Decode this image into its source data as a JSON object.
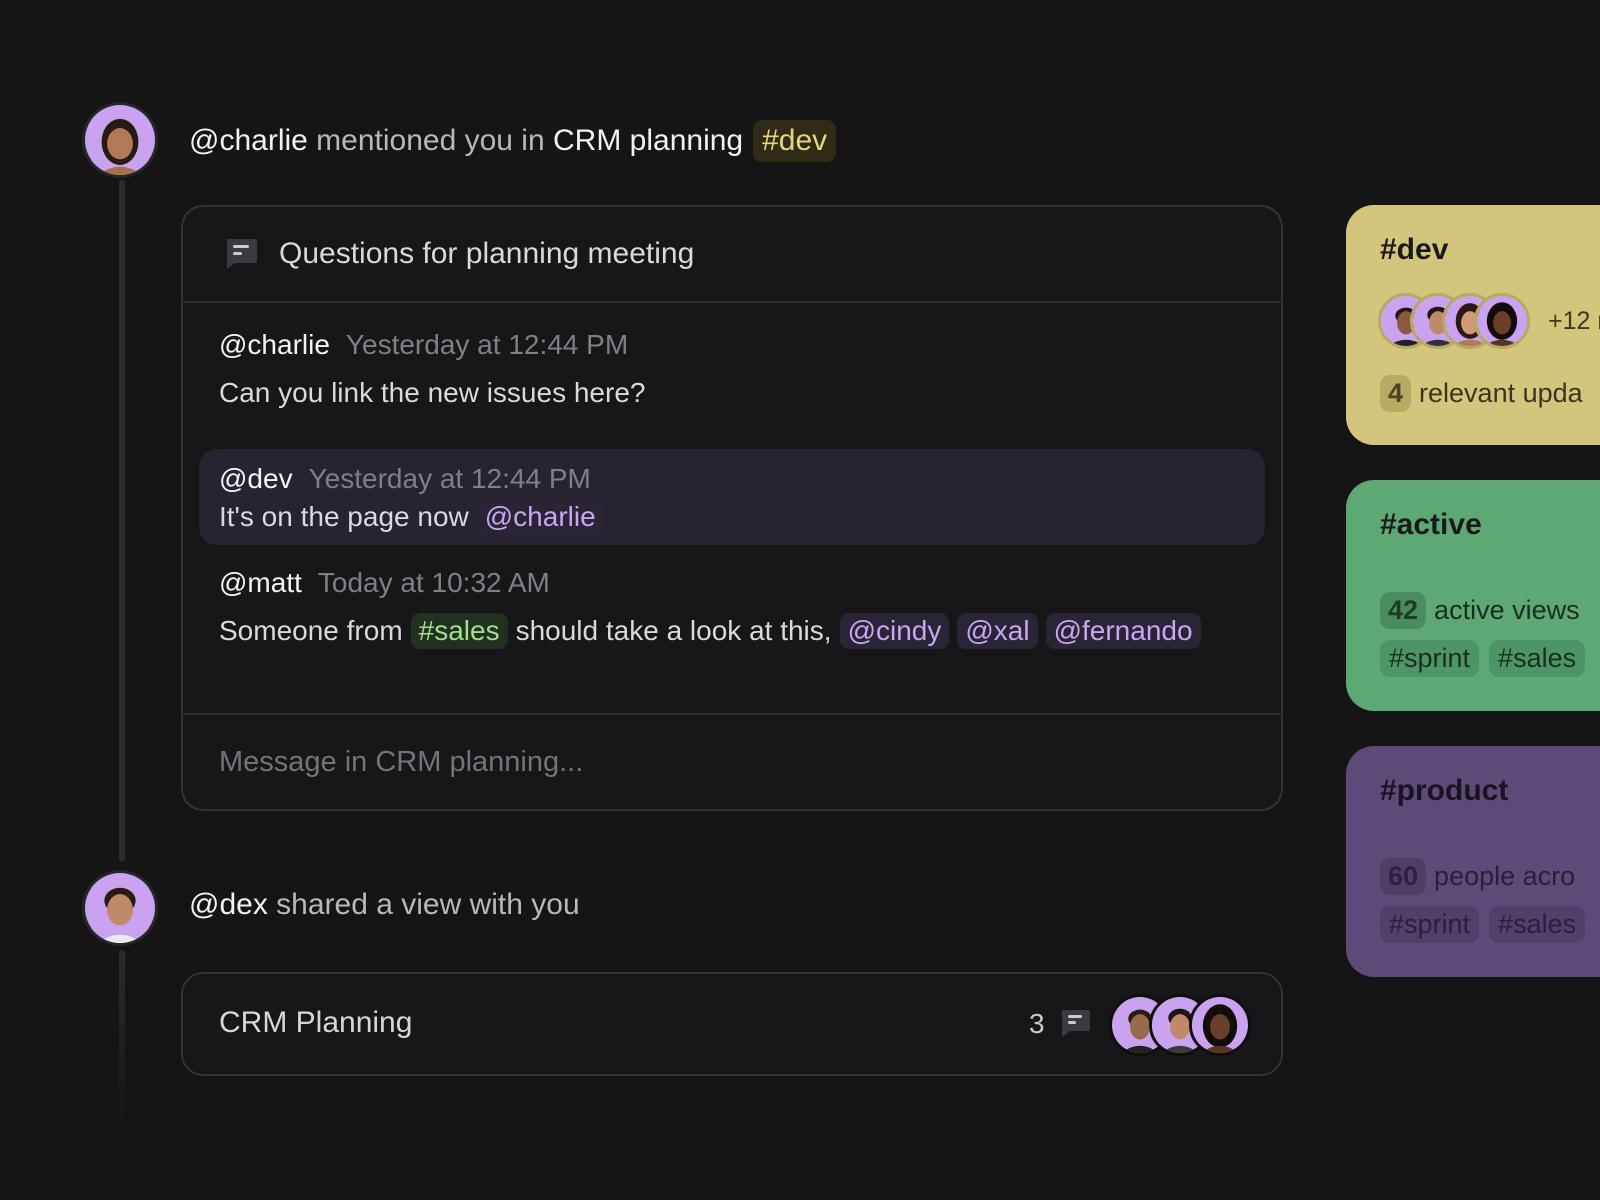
{
  "events": [
    {
      "actor": "@charlie",
      "action": "mentioned you in",
      "target": "CRM planning",
      "tag": "#dev",
      "thread": {
        "title": "Questions for planning meeting",
        "messages": [
          {
            "author": "@charlie",
            "time": "Yesterday at 12:44 PM",
            "text": "Can you link the new issues here?"
          },
          {
            "author": "@dev",
            "time": "Yesterday at 12:44 PM",
            "text": "It's on the page now",
            "mention": "@charlie"
          },
          {
            "author": "@matt",
            "time": "Today at 10:32 AM",
            "text_before": "Someone from",
            "tag": "#sales",
            "text_after": "should take a look at this,",
            "mentions": [
              "@cindy",
              "@xal",
              "@fernando"
            ]
          }
        ],
        "composer_placeholder": "Message in CRM planning..."
      }
    },
    {
      "actor": "@dex",
      "action": "shared a view with you",
      "view": {
        "title": "CRM Planning",
        "comment_count": "3"
      }
    }
  ],
  "side_cards": [
    {
      "title": "#dev",
      "more": "+12 r",
      "count": "4",
      "label": "relevant upda",
      "color": "#d4c57c"
    },
    {
      "title": "#active",
      "count": "42",
      "label": "active views",
      "tags": [
        "#sprint",
        "#sales"
      ],
      "color": "#5ea874"
    },
    {
      "title": "#product",
      "count": "60",
      "label": "people acro",
      "tags": [
        "#sprint",
        "#sales"
      ],
      "color": "#5d4a79"
    }
  ],
  "icons": [
    "thread-icon",
    "comment-icon",
    "avatar"
  ],
  "colors": {
    "background": "#151516",
    "mention": "#c6a7f3",
    "tag_dev": "#e6d57e",
    "tag_sales": "#9fe08b"
  }
}
